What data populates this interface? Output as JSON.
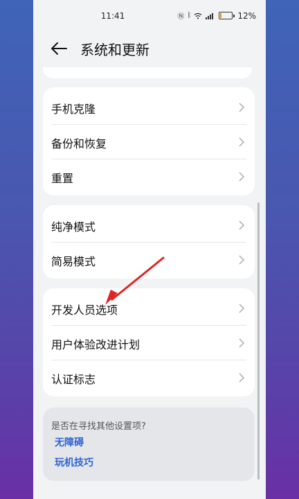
{
  "status_bar": {
    "time": "11:41",
    "battery_percent": "12%",
    "battery_level": 0.12
  },
  "header": {
    "title": "系统和更新",
    "back_icon": "arrow-left-icon"
  },
  "groups": [
    {
      "items": [
        {
          "label": "手机克隆"
        },
        {
          "label": "备份和恢复"
        },
        {
          "label": "重置"
        }
      ]
    },
    {
      "items": [
        {
          "label": "纯净模式"
        },
        {
          "label": "简易模式"
        }
      ]
    },
    {
      "items": [
        {
          "label": "开发人员选项"
        },
        {
          "label": "用户体验改进计划"
        },
        {
          "label": "认证标志"
        }
      ]
    }
  ],
  "suggestions": {
    "title": "是否在寻找其他设置项?",
    "links": [
      {
        "label": "无障碍"
      },
      {
        "label": "玩机技巧"
      }
    ]
  },
  "annotation": {
    "color": "#e02424"
  }
}
